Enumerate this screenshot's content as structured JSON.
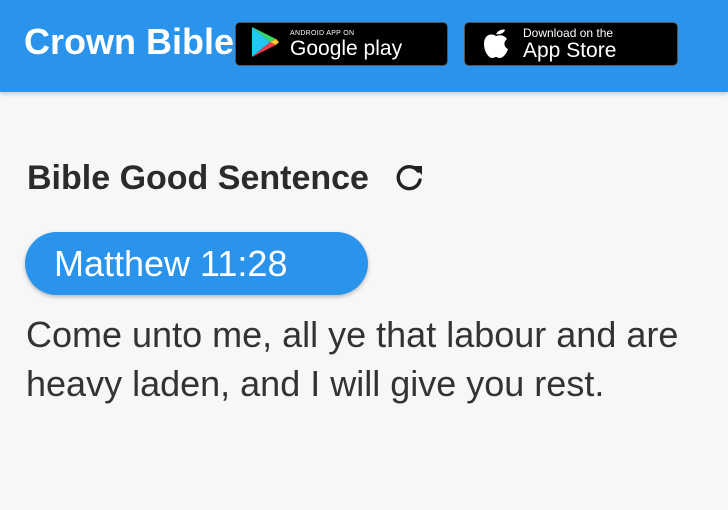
{
  "header": {
    "app_title": "Crown Bible",
    "google_play": {
      "small_text": "ANDROID APP ON",
      "big_text": "Google play",
      "icon": "google-play-icon"
    },
    "app_store": {
      "small_text": "Download on the",
      "big_text": "App Store",
      "icon": "apple-icon"
    }
  },
  "section": {
    "title": "Bible Good Sentence",
    "refresh_icon": "refresh-icon"
  },
  "verse": {
    "reference": "Matthew 11:28",
    "text": "Come unto me, all ye that labour and are heavy laden, and I will give you rest."
  },
  "colors": {
    "primary": "#2a93eb",
    "background": "#f7f7f7",
    "text": "#333333"
  }
}
